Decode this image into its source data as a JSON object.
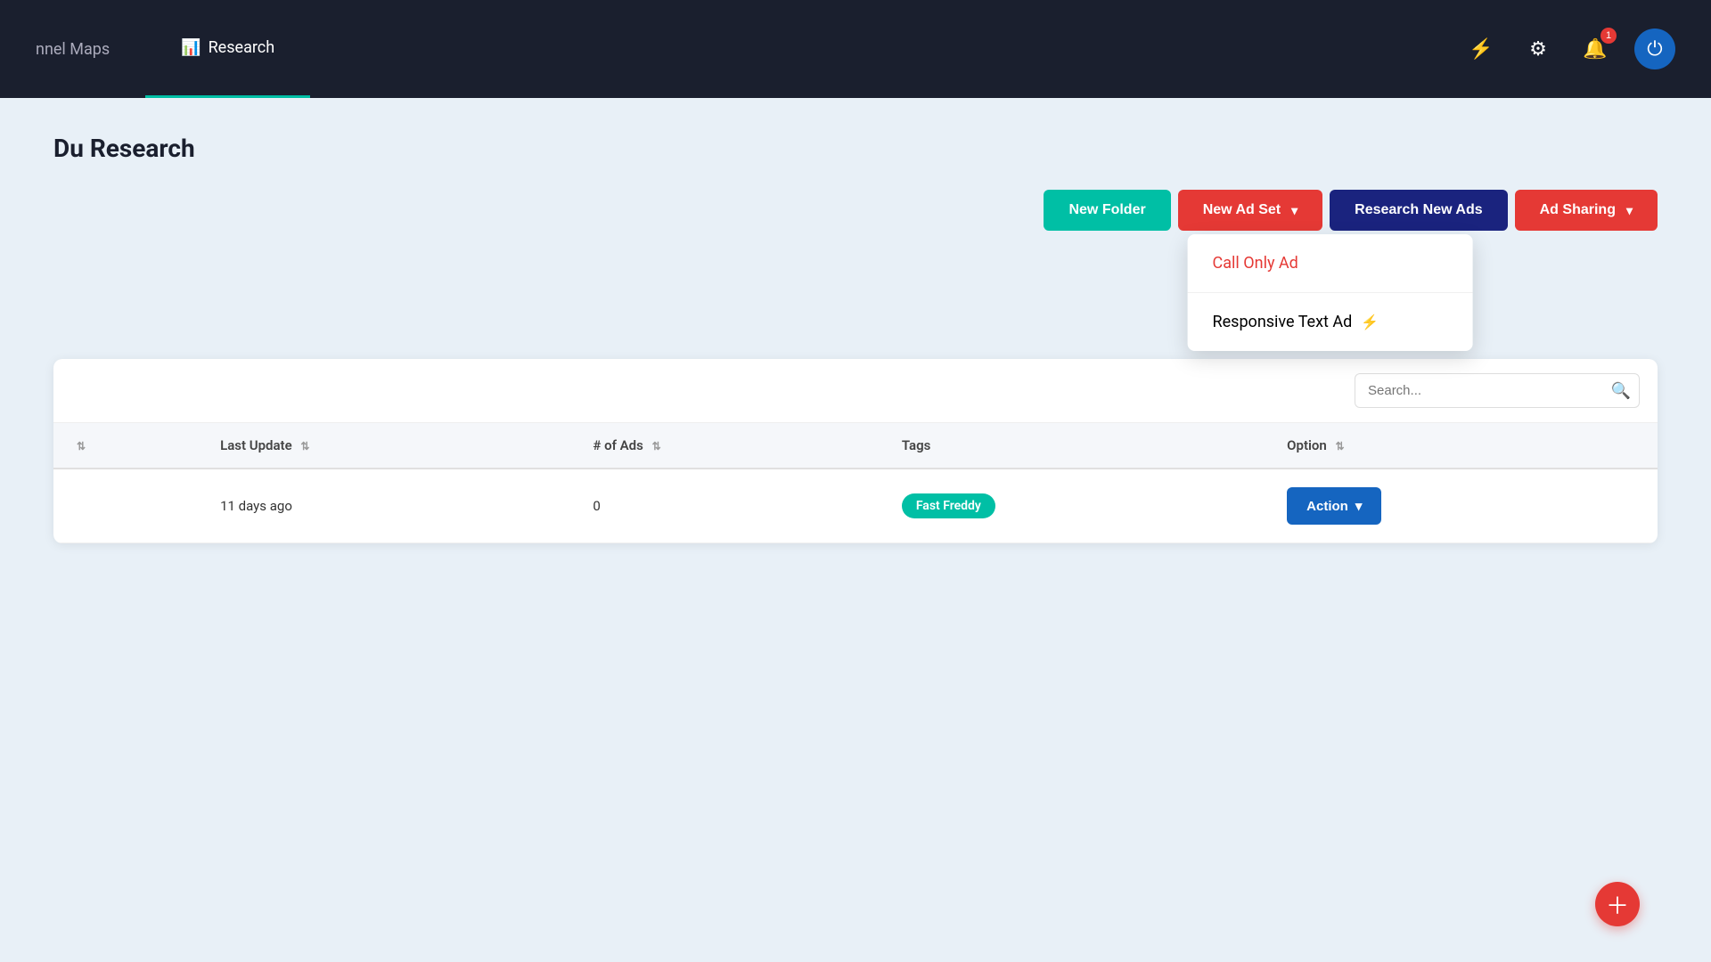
{
  "navbar": {
    "nav_items": [
      {
        "id": "funnel-maps",
        "label": "nnel Maps",
        "icon": ""
      },
      {
        "id": "research",
        "label": "Research",
        "icon": "📊"
      }
    ],
    "icons": {
      "bolt": "⚡",
      "gear": "⚙",
      "bell": "🔔",
      "notification_count": "1",
      "power": "⏻"
    }
  },
  "breadcrumb": {
    "title": "Du Research"
  },
  "toolbar": {
    "new_folder_label": "New Folder",
    "new_ad_set_label": "New Ad Set",
    "research_new_ads_label": "Research New Ads",
    "ad_sharing_label": "Ad Sharing"
  },
  "dropdown": {
    "items": [
      {
        "id": "call-only-ad",
        "label": "Call Only Ad",
        "style": "red"
      },
      {
        "id": "responsive-text-ad",
        "label": "Responsive Text Ad",
        "icon": "bolt"
      }
    ]
  },
  "table": {
    "search_placeholder": "Search...",
    "columns": [
      {
        "id": "col-empty",
        "label": ""
      },
      {
        "id": "col-last-update",
        "label": "Last Update"
      },
      {
        "id": "col-num-ads",
        "label": "# of Ads"
      },
      {
        "id": "col-tags",
        "label": "Tags"
      },
      {
        "id": "col-option",
        "label": "Option"
      }
    ],
    "rows": [
      {
        "last_update": "11 days ago",
        "num_ads": "0",
        "tags": [
          "Fast Freddy"
        ],
        "action_label": "Action"
      }
    ]
  }
}
